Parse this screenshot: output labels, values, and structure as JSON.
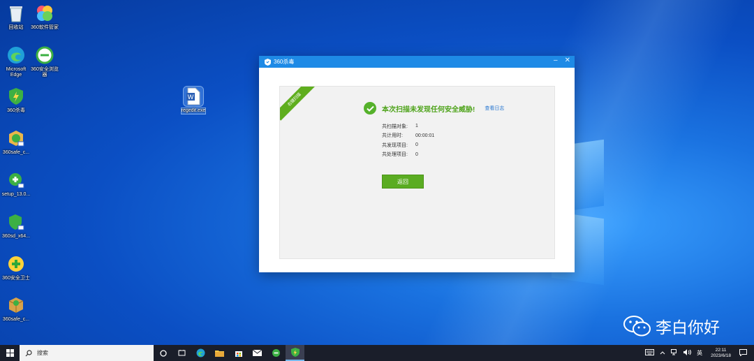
{
  "desktop_icons": [
    {
      "label": "回收站",
      "icon": "recycle-bin-icon"
    },
    {
      "label": "360软件管家",
      "icon": "software-manager-icon"
    },
    {
      "label": "Microsoft Edge",
      "icon": "edge-icon"
    },
    {
      "label": "360安全浏览器",
      "icon": "browser-icon"
    },
    {
      "label": "360杀毒",
      "icon": "antivirus-icon"
    },
    {
      "label": "regedit.exe",
      "icon": "word-doc-icon"
    },
    {
      "label": "360safe_c...",
      "icon": "installer-icon"
    },
    {
      "label": "setup_13.0...",
      "icon": "installer-icon"
    },
    {
      "label": "360sd_x64...",
      "icon": "installer-icon"
    },
    {
      "label": "360安全卫士",
      "icon": "security-guard-icon"
    },
    {
      "label": "360safe_c...",
      "icon": "package-icon"
    }
  ],
  "window": {
    "title": "360杀毒",
    "minimize": "–",
    "close": "✕",
    "ribbon": "右键扫描",
    "result_title": "本次扫描未发现任何安全威胁!",
    "log_link": "查看日志",
    "stats": [
      {
        "label": "共扫描对象:",
        "value": "1"
      },
      {
        "label": "共计用时:",
        "value": "00:00:01"
      },
      {
        "label": "共发现项目:",
        "value": "0"
      },
      {
        "label": "共处理项目:",
        "value": "0"
      }
    ],
    "back_button": "返回"
  },
  "watermark": "李白你好",
  "taskbar": {
    "search_placeholder": "搜索",
    "tray_lang": "英",
    "clock_time": "22:11",
    "clock_date": "2023/6/18"
  },
  "colors": {
    "title_bar": "#1e8ae6",
    "success_green": "#55b12b",
    "button_green": "#5aac22",
    "taskbar": "#1a1e2a"
  }
}
